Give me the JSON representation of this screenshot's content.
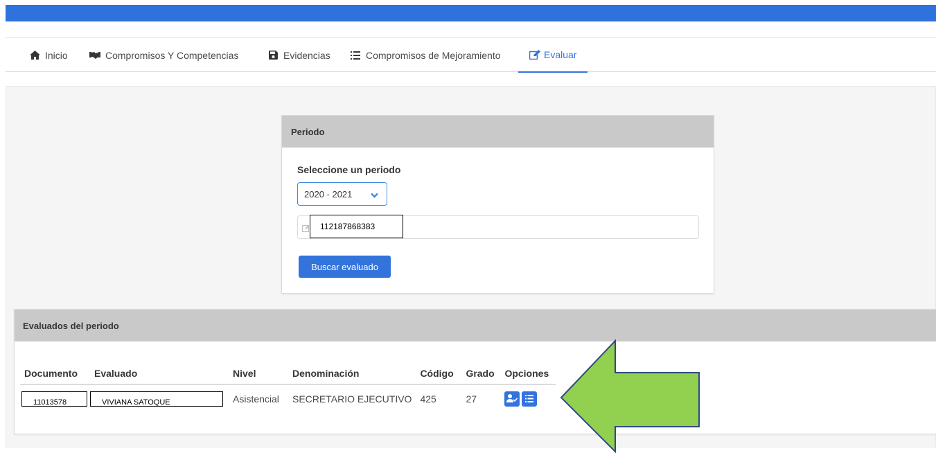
{
  "colors": {
    "topbar": "#2f72dd",
    "accent": "#3273dc",
    "panel_header": "#c9c9c9",
    "arrow_fill": "#92d050",
    "arrow_stroke": "#2f4b7c"
  },
  "nav": {
    "tabs": [
      {
        "label": "Inicio",
        "icon": "home-icon"
      },
      {
        "label": "Compromisos Y Competencias",
        "icon": "handshake-icon"
      },
      {
        "label": "Evidencias",
        "icon": "save-icon"
      },
      {
        "label": "Compromisos de Mejoramiento",
        "icon": "list-icon"
      },
      {
        "label": "Evaluar",
        "icon": "edit-icon",
        "active": true
      }
    ]
  },
  "periodo": {
    "title": "Periodo",
    "select_label": "Seleccione un periodo",
    "selected": "2020 - 2021",
    "search_value": "112187868383",
    "search_button": "Buscar evaluado"
  },
  "evaluados": {
    "title": "Evaluados del periodo",
    "columns": [
      "Documento",
      "Evaluado",
      "Nivel",
      "Denominación",
      "Código",
      "Grado",
      "Opciones"
    ],
    "rows": [
      {
        "documento": "11013578",
        "evaluado": "VIVIANA SATOQUE",
        "nivel": "Asistencial",
        "denominacion": "SECRETARIO EJECUTIVO",
        "codigo": "425",
        "grado": "27",
        "opciones": [
          "evaluate-user-icon",
          "list-icon"
        ]
      }
    ]
  }
}
